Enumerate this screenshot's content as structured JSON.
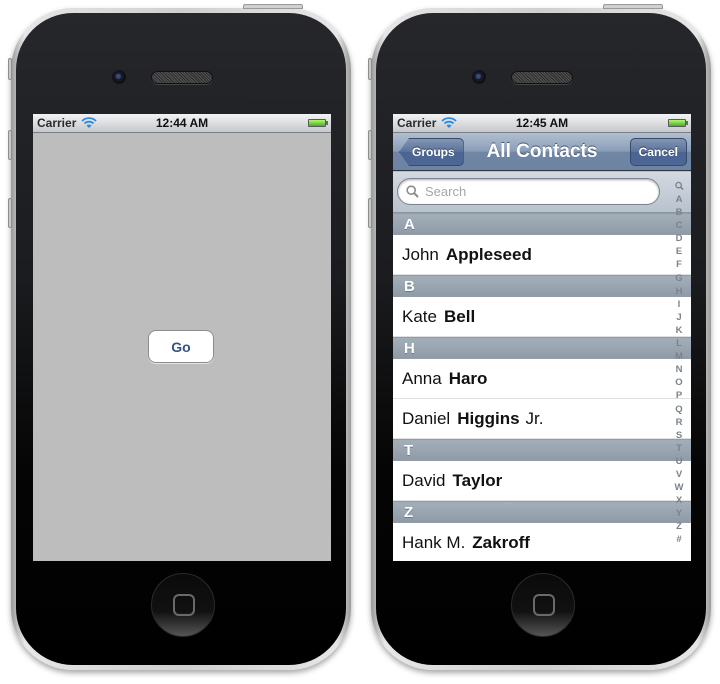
{
  "left_phone": {
    "status_bar": {
      "carrier": "Carrier",
      "time": "12:44 AM"
    },
    "go_button": {
      "label": "Go"
    }
  },
  "right_phone": {
    "status_bar": {
      "carrier": "Carrier",
      "time": "12:45 AM"
    },
    "nav_bar": {
      "title": "All Contacts",
      "back_button": "Groups",
      "cancel_button": "Cancel"
    },
    "search": {
      "placeholder": "Search",
      "value": ""
    },
    "sections": [
      {
        "letter": "A",
        "contacts": [
          {
            "first": "John",
            "last": "Appleseed",
            "suffix": ""
          }
        ]
      },
      {
        "letter": "B",
        "contacts": [
          {
            "first": "Kate",
            "last": "Bell",
            "suffix": ""
          }
        ]
      },
      {
        "letter": "H",
        "contacts": [
          {
            "first": "Anna",
            "last": "Haro",
            "suffix": ""
          },
          {
            "first": "Daniel",
            "last": "Higgins",
            "suffix": "Jr."
          }
        ]
      },
      {
        "letter": "T",
        "contacts": [
          {
            "first": "David",
            "last": "Taylor",
            "suffix": ""
          }
        ]
      },
      {
        "letter": "Z",
        "contacts": [
          {
            "first": "Hank M.",
            "last": "Zakroff",
            "suffix": ""
          }
        ]
      }
    ],
    "index_letters": [
      "A",
      "B",
      "C",
      "D",
      "E",
      "F",
      "G",
      "H",
      "I",
      "J",
      "K",
      "L",
      "M",
      "N",
      "O",
      "P",
      "Q",
      "R",
      "S",
      "T",
      "U",
      "V",
      "W",
      "X",
      "Y",
      "Z",
      "#"
    ]
  },
  "icons": {
    "wifi": "wifi-icon",
    "battery": "battery-icon",
    "search": "magnifier-icon",
    "home": "home-button-icon"
  },
  "colors": {
    "nav_bar": "#7a8fae",
    "go_text": "#395281",
    "screen_bg": "#bdbdbd",
    "section_header": "#98a4b0",
    "battery_green": "#3fb22a",
    "wifi_blue": "#2a8be0"
  }
}
